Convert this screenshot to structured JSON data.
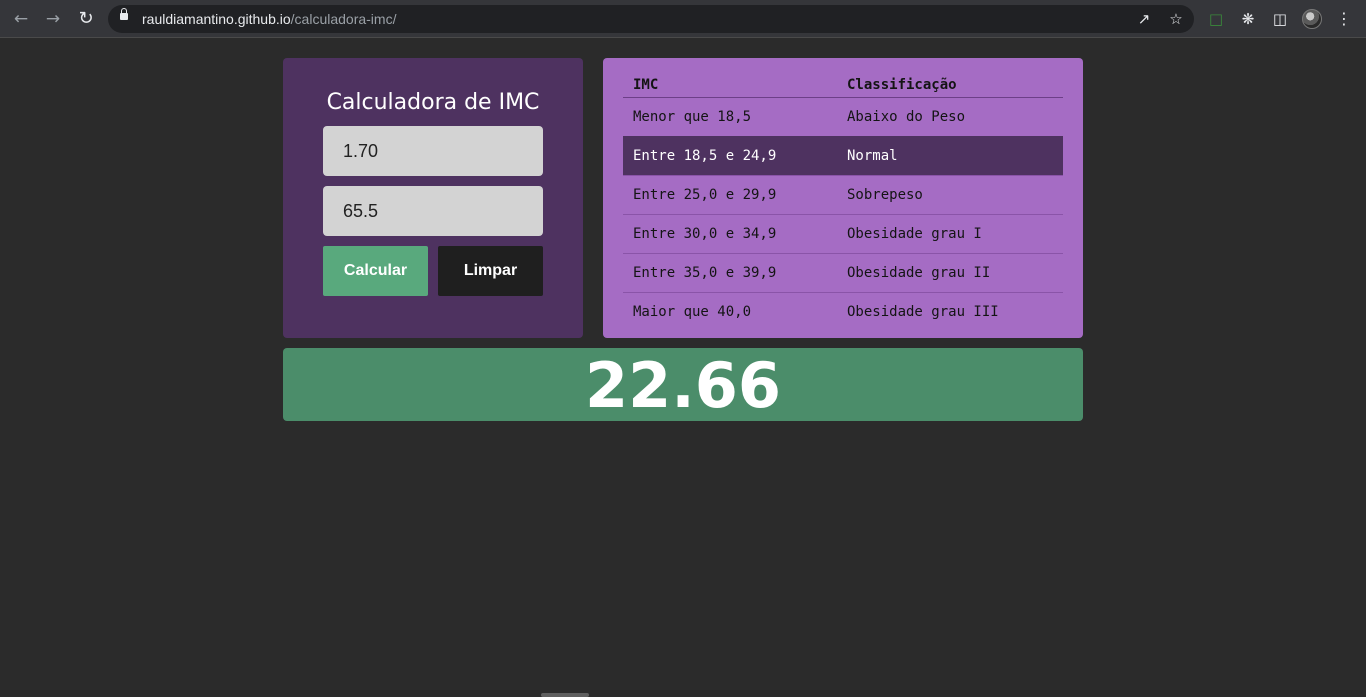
{
  "browser": {
    "url_domain": "rauldiamantino.github.io",
    "url_path": "/calculadora-imc/",
    "icons": {
      "back": "arrow-left-icon",
      "forward": "arrow-right-icon",
      "reload": "reload-icon",
      "lock": "lock-icon",
      "share": "share-icon",
      "star": "star-icon",
      "extension": "screen-capture-icon",
      "extensions": "puzzle-icon",
      "side_panel": "side-panel-icon",
      "menu": "kebab-menu-icon"
    }
  },
  "calculator": {
    "title": "Calculadora de IMC",
    "altura_value": "1.70",
    "peso_value": "65.5",
    "calcular_label": "Calcular",
    "limpar_label": "Limpar"
  },
  "table": {
    "headers": [
      "IMC",
      "Classificação"
    ],
    "rows": [
      {
        "imc": "Menor que 18,5",
        "classificacao": "Abaixo do Peso"
      },
      {
        "imc": "Entre 18,5 e 24,9",
        "classificacao": "Normal"
      },
      {
        "imc": "Entre 25,0 e 29,9",
        "classificacao": "Sobrepeso"
      },
      {
        "imc": "Entre 30,0 e 34,9",
        "classificacao": "Obesidade grau I"
      },
      {
        "imc": "Entre 35,0 e 39,9",
        "classificacao": "Obesidade grau II"
      },
      {
        "imc": "Maior que 40,0",
        "classificacao": "Obesidade grau III"
      }
    ],
    "highlighted_row": 1
  },
  "result": {
    "value": "22.66"
  },
  "colors": {
    "page_bg": "#2b2b2b",
    "calc_card_bg": "#4e3260",
    "table_card_bg": "#a56cc4",
    "highlight_row_bg": "#4e3260",
    "calcular_button": "#59a97d",
    "limpar_button": "#1f1f1f",
    "result_bg": "#4b8d6a"
  }
}
